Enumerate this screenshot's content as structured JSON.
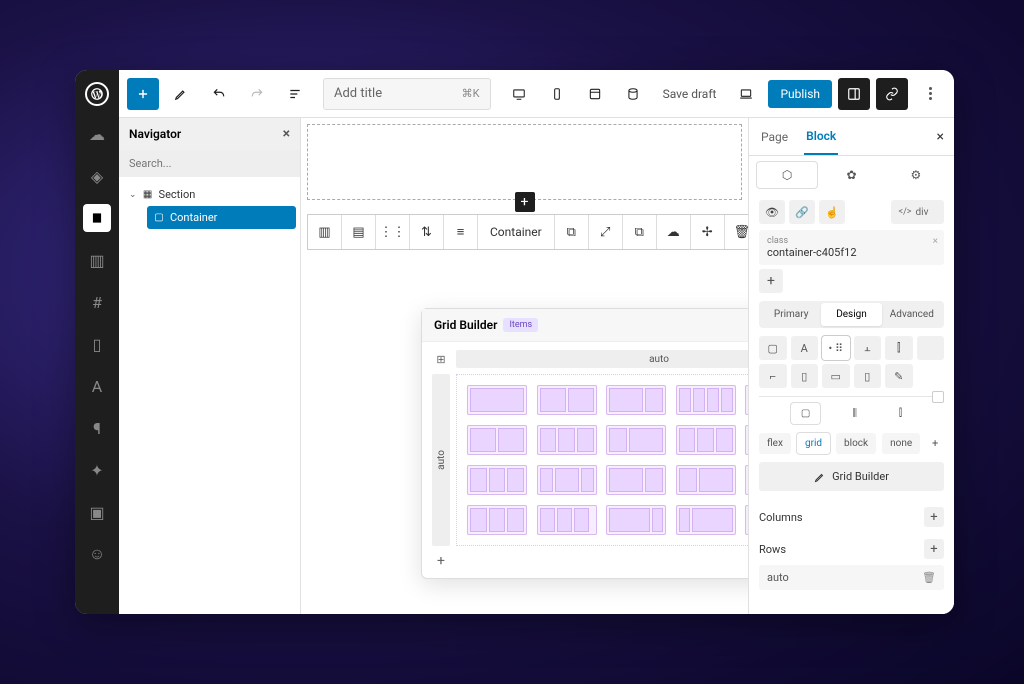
{
  "sidebar": {
    "icons": [
      "cloud",
      "plugin",
      "page",
      "layout",
      "frame",
      "columns",
      "text",
      "paragraph",
      "sparkle",
      "image",
      "emoji"
    ]
  },
  "topbar": {
    "title_placeholder": "Add title",
    "shortcut": "⌘K",
    "save_draft": "Save draft",
    "publish": "Publish"
  },
  "navigator": {
    "title": "Navigator",
    "search_placeholder": "Search...",
    "items": [
      {
        "label": "Section",
        "icon": "section",
        "selected": false
      },
      {
        "label": "Container",
        "icon": "container",
        "selected": true
      }
    ]
  },
  "block_toolbar": {
    "label": "Container"
  },
  "grid_builder": {
    "title": "Grid Builder",
    "badge": "Items",
    "axis_label": "auto"
  },
  "right_panel": {
    "tabs": {
      "page": "Page",
      "block": "Block"
    },
    "element_tag": "div",
    "class_label": "class",
    "class_value": "container-c405f12",
    "pill_tabs": {
      "primary": "Primary",
      "design": "Design",
      "advanced": "Advanced"
    },
    "display": {
      "flex": "flex",
      "grid": "grid",
      "block": "block",
      "none": "none"
    },
    "grid_builder_btn": "Grid Builder",
    "columns_label": "Columns",
    "rows_label": "Rows",
    "row_value": "auto"
  }
}
